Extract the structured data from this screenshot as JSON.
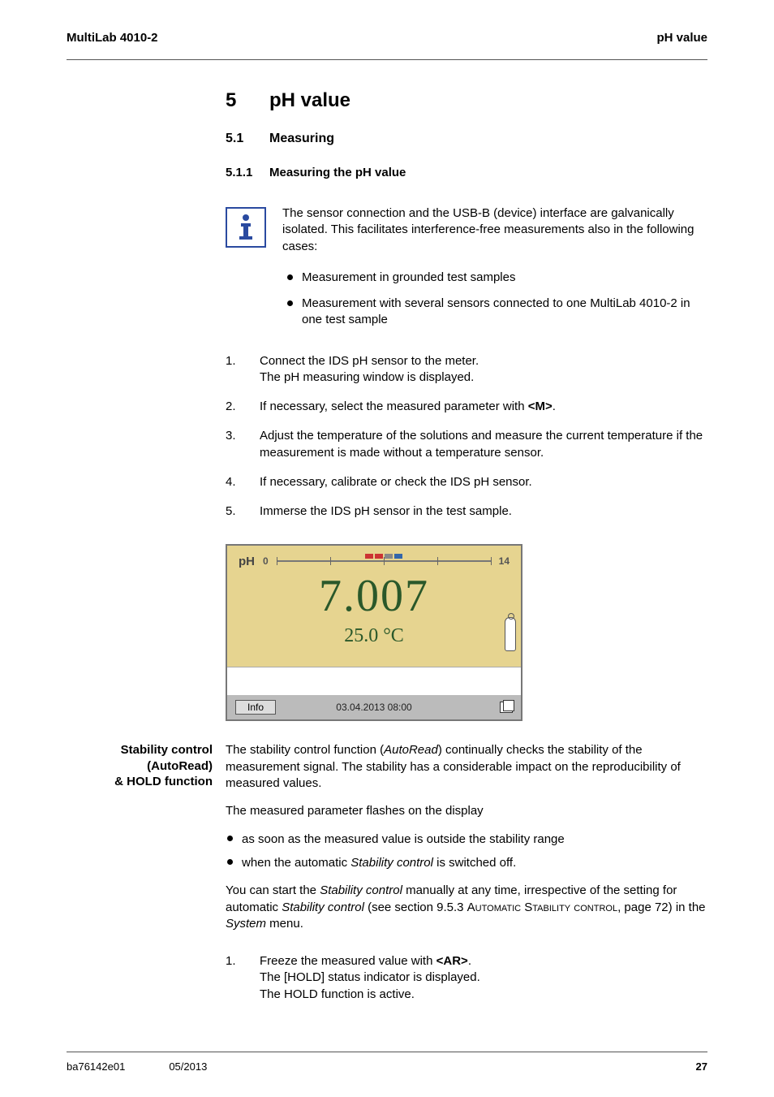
{
  "header": {
    "left": "MultiLab 4010-2",
    "right": "pH value"
  },
  "heading": {
    "num": "5",
    "title": "pH value"
  },
  "sec": {
    "num": "5.1",
    "title": "Measuring"
  },
  "subsec": {
    "num": "5.1.1",
    "title": "Measuring the pH value"
  },
  "info_para": "The sensor connection and the USB-B (device) interface are galvanically isolated. This facilitates interference-free measurements also in the following cases:",
  "info_bullets": [
    "Measurement in grounded test samples",
    "Measurement with several sensors connected to one MultiLab 4010-2 in one test sample"
  ],
  "steps_a": [
    {
      "n": "1.",
      "t": "Connect the IDS pH sensor to the meter.\nThe pH measuring window is displayed."
    },
    {
      "n": "2.",
      "t_pre": "If necessary, select the measured parameter with ",
      "key": "<M>",
      "t_post": "."
    },
    {
      "n": "3.",
      "t": "Adjust the temperature of the solutions and measure the current temperature if the measurement is made without a temperature sensor."
    },
    {
      "n": "4.",
      "t": "If necessary, calibrate or check the IDS pH sensor."
    },
    {
      "n": "5.",
      "t": "Immerse the IDS pH sensor in the test sample."
    }
  ],
  "screen": {
    "ph_label": "pH",
    "scale_min": "0",
    "scale_max": "14",
    "reading": "7.007",
    "temp": "25.0 °C",
    "info_btn": "Info",
    "datetime": "03.04.2013 08:00"
  },
  "side": {
    "label1": "Stability control",
    "label2": "(AutoRead)",
    "label3": "& HOLD function"
  },
  "stab": {
    "p1_a": "The stability control function (",
    "p1_it": "AutoRead",
    "p1_b": ") continually checks the stability of the measurement signal. The stability has a considerable impact on the reproducibility of measured values.",
    "p2": "The measured parameter flashes on the display",
    "b1": "as soon as the measured value is outside the stability range",
    "b2_a": "when the automatic ",
    "b2_it": "Stability control",
    "b2_b": " is switched off.",
    "p3_a": "You can start the ",
    "p3_it1": "Stability control",
    "p3_b": " manually at any time, irrespective of the setting for automatic ",
    "p3_it2": "Stability control",
    "p3_c": " (see section 9.5.3 ",
    "p3_sc": "Automatic Stability control",
    "p3_d": ", page 72) in the ",
    "p3_it3": "System",
    "p3_e": " menu."
  },
  "steps_b": [
    {
      "n": "1.",
      "pre": "Freeze the measured value with ",
      "key": "<AR>",
      "post": ".\nThe [HOLD] status indicator is displayed.\nThe HOLD function is active."
    }
  ],
  "footer": {
    "doc": "ba76142e01",
    "date": "05/2013",
    "page": "27"
  }
}
